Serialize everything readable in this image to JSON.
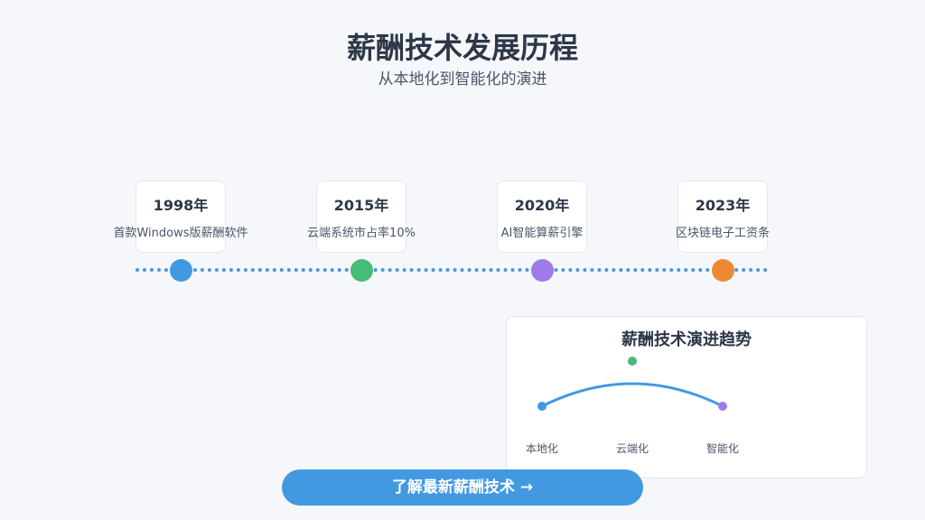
{
  "header": {
    "title": "薪酬技术发展历程",
    "subtitle": "从本地化到智能化的演进"
  },
  "timeline": {
    "line_color": "#4299e1",
    "events": [
      {
        "year": "1998年",
        "desc": "首款Windows版薪酬软件",
        "color": "#4299e1"
      },
      {
        "year": "2015年",
        "desc": "云端系统市占率10%",
        "color": "#48bb78"
      },
      {
        "year": "2020年",
        "desc": "AI智能算薪引擎",
        "color": "#9f7aea"
      },
      {
        "year": "2023年",
        "desc": "区块链电子工资条",
        "color": "#ed8936"
      }
    ]
  },
  "trend": {
    "title": "薪酬技术演进趋势",
    "stages": [
      {
        "label": "本地化",
        "color": "#4299e1"
      },
      {
        "label": "云端化",
        "color": "#48bb78"
      },
      {
        "label": "智能化",
        "color": "#9f7aea"
      }
    ]
  },
  "cta": {
    "label": "了解最新薪酬技术 →",
    "color": "#4299e1"
  }
}
